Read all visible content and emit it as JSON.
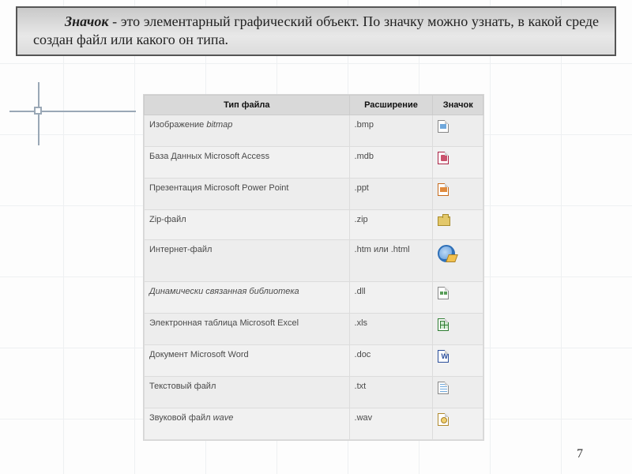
{
  "definition": {
    "term": "Значок",
    "dash": " - ",
    "text": "это элементарный графический объект. По значку можно узнать, в какой среде создан файл или какого он типа."
  },
  "table": {
    "headers": {
      "type": "Тип файла",
      "ext": "Расширение",
      "icon": "Значок"
    },
    "rows": [
      {
        "type_prefix": "Изображение ",
        "type_italic": "bitmap",
        "ext": ".bmp",
        "icon": "bmp-icon"
      },
      {
        "type_prefix": "База Данных Microsoft Access",
        "type_italic": "",
        "ext": ".mdb",
        "icon": "mdb-icon"
      },
      {
        "type_prefix": "Презентация Microsoft Power Point",
        "type_italic": "",
        "ext": ".ppt",
        "icon": "ppt-icon"
      },
      {
        "type_prefix": "Zip-файл",
        "type_italic": "",
        "ext": ".zip",
        "icon": "zip-icon"
      },
      {
        "type_prefix": "Интернет-файл",
        "type_italic": "",
        "ext": ".htm или .html",
        "icon": "html-icon"
      },
      {
        "type_prefix": "",
        "type_italic": "Динамически связанная библиотека",
        "ext": ".dll",
        "icon": "dll-icon"
      },
      {
        "type_prefix": "Электронная таблица Microsoft Excel",
        "type_italic": "",
        "ext": ".xls",
        "icon": "xls-icon"
      },
      {
        "type_prefix": "Документ Microsoft Word",
        "type_italic": "",
        "ext": ".doc",
        "icon": "doc-icon"
      },
      {
        "type_prefix": "Текстовый файл",
        "type_italic": "",
        "ext": ".txt",
        "icon": "txt-icon"
      },
      {
        "type_prefix": "Звуковой файл ",
        "type_italic": "wave",
        "ext": ".wav",
        "icon": "wav-icon"
      }
    ]
  },
  "page_number": "7"
}
